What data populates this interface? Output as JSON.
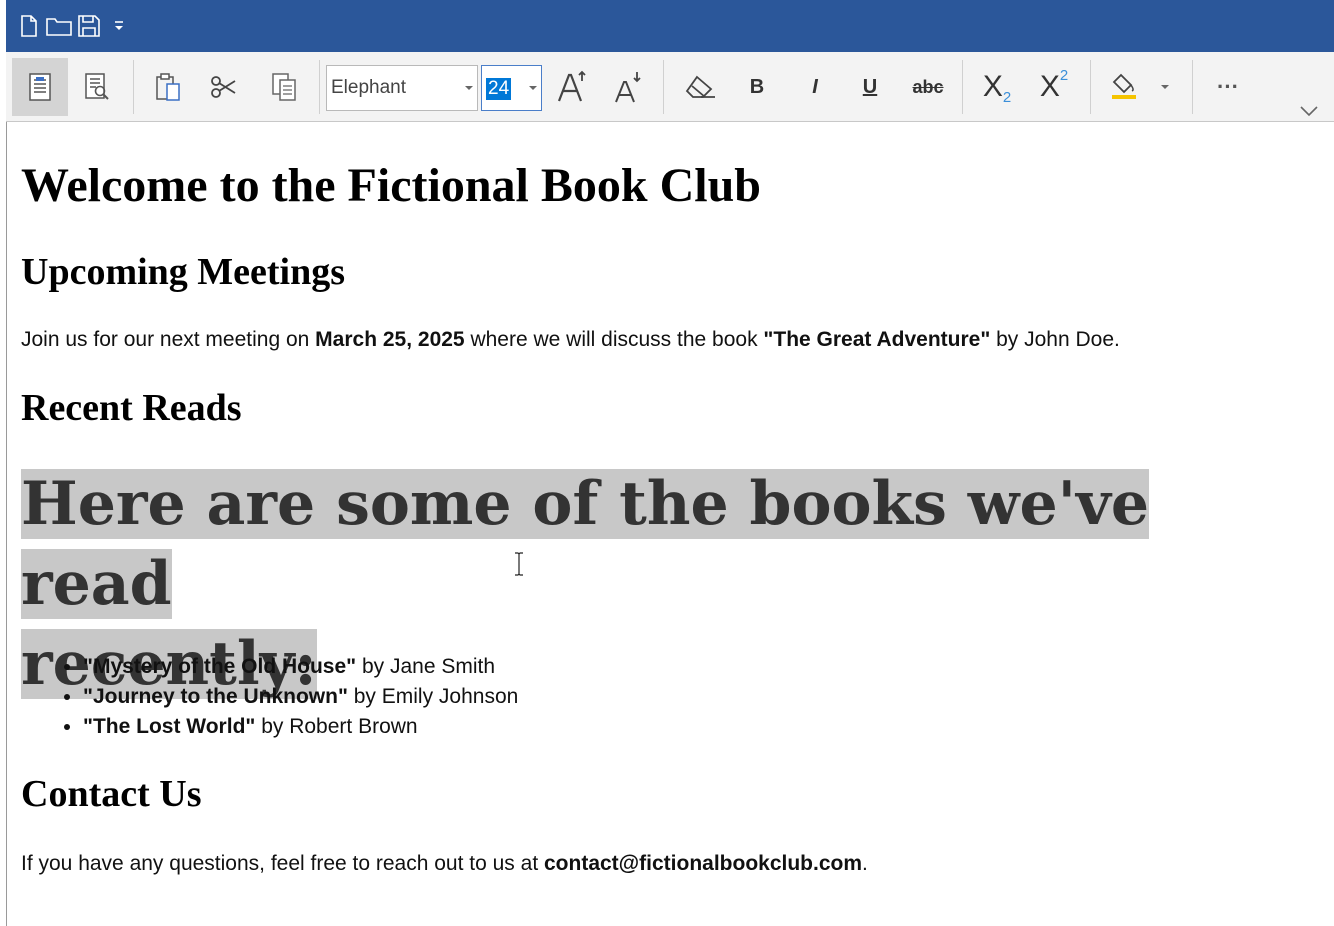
{
  "quick_access": {
    "icons": [
      "new-document-icon",
      "open-folder-icon",
      "save-icon",
      "customize-quick-access-icon"
    ]
  },
  "ribbon": {
    "font_name": "Elephant",
    "font_size": "24",
    "bold_label": "B",
    "italic_label": "I",
    "underline_label": "U",
    "strikethrough_label": "abc",
    "subscript_label": "X",
    "subscript_mark": "2",
    "superscript_label": "X",
    "superscript_mark": "2",
    "more_label": "···",
    "grow_font_label": "A",
    "shrink_font_label": "A",
    "highlight_color": "#f5c400",
    "selection_color": "#0078d7"
  },
  "document": {
    "title": "Welcome to the Fictional Book Club",
    "meetings_heading": "Upcoming Meetings",
    "meetings_text": {
      "part1": "Join us for our next meeting on ",
      "date": "March 25, 2025",
      "part2": " where we will discuss the book ",
      "book": "\"The Great Adventure\"",
      "part3": " by John Doe."
    },
    "recent_heading": "Recent Reads",
    "recent_intro_line1": "Here are some of the books we've read",
    "recent_intro_line2": "recently:",
    "books": [
      {
        "title": "\"Mystery of the Old House\"",
        "author": " by Jane Smith"
      },
      {
        "title": "\"Journey to the Unknown\"",
        "author": " by Emily Johnson"
      },
      {
        "title": "\"The Lost World\"",
        "author": " by Robert Brown"
      }
    ],
    "contact_heading": "Contact Us",
    "contact_text": {
      "part1": "If you have any questions, feel free to reach out to us at ",
      "email": "contact@fictionalbookclub.com",
      "part2": "."
    }
  }
}
